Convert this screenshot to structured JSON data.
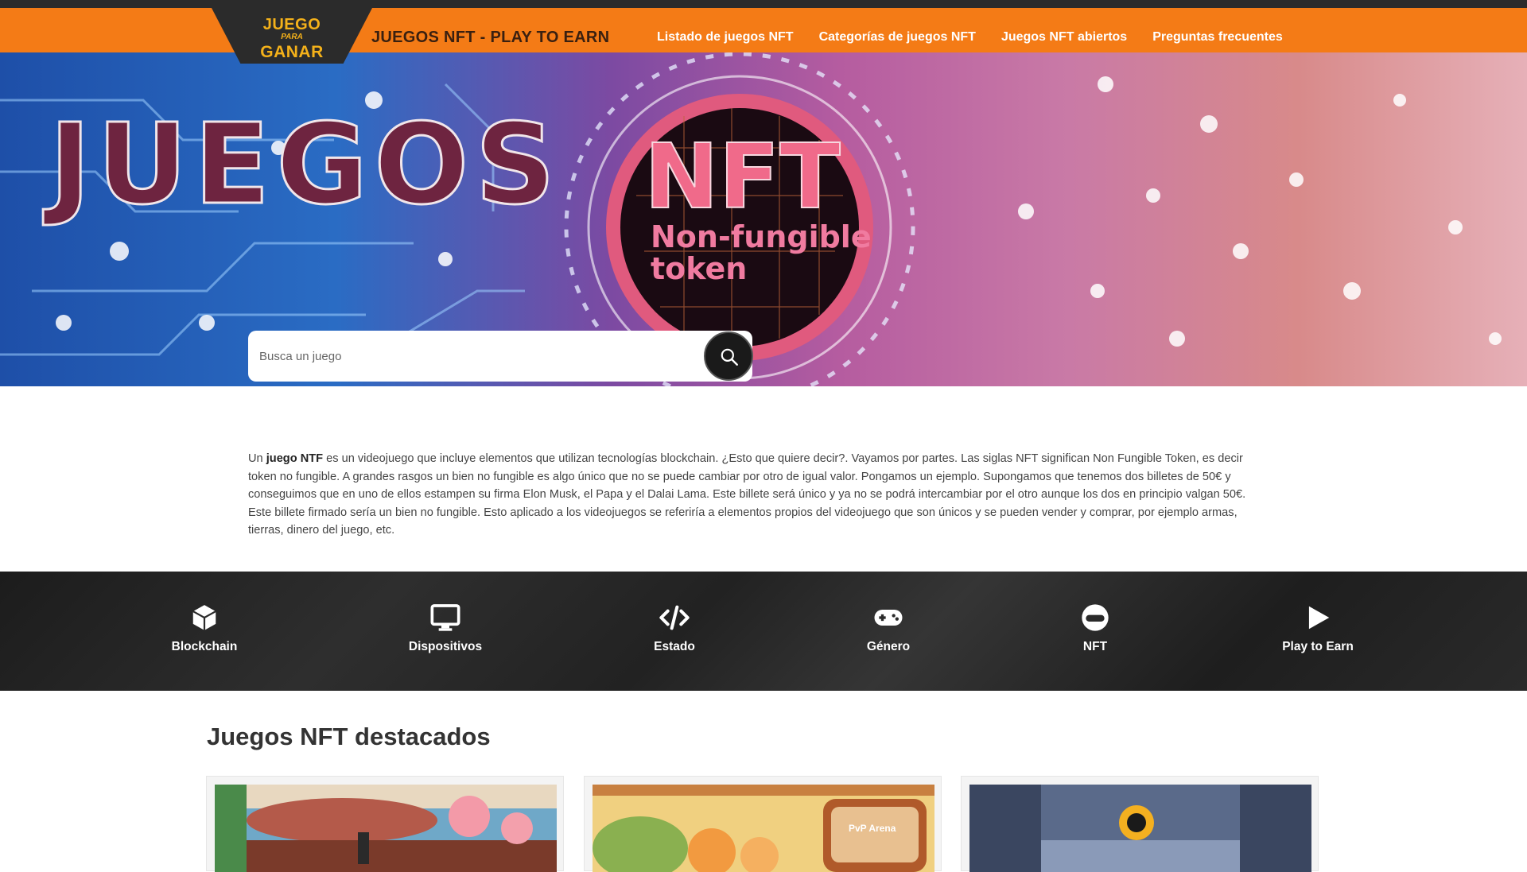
{
  "logo": {
    "line1": "JUEGO",
    "line2": "PARA",
    "line3": "GANAR"
  },
  "brand_text": "JUEGOS NFT - PLAY TO EARN",
  "nav": [
    {
      "label": "Listado de juegos NFT"
    },
    {
      "label": "Categorías de juegos NFT"
    },
    {
      "label": "Juegos NFT abiertos"
    },
    {
      "label": "Preguntas frecuentes"
    }
  ],
  "hero": {
    "title": "JUEGOS",
    "badge_title": "NFT",
    "badge_sub_1": "Non-fungible",
    "badge_sub_2": "token"
  },
  "search": {
    "placeholder": "Busca un juego",
    "value": ""
  },
  "intro": {
    "lead": "Un ",
    "bold": "juego NTF",
    "rest": " es un videojuego que incluye elementos que utilizan tecnologías blockchain. ¿Esto que quiere decir?. Vayamos por partes. Las siglas  NFT significan Non Fungible Token, es decir token no fungible. A grandes rasgos un bien no fungible es algo único que no se puede cambiar por otro de igual valor. Pongamos un ejemplo. Supongamos que tenemos dos billetes de 50€ y conseguimos que en uno de ellos estampen su firma Elon Musk, el Papa y el Dalai Lama. Este billete será único y ya no se podrá intercambiar por el otro aunque los dos en principio valgan 50€. Este billete firmado sería un bien no fungible. Esto aplicado a los videojuegos se referiría a elementos propios del videojuego que son únicos y se pueden vender y comprar, por ejemplo armas, tierras, dinero del juego, etc."
  },
  "categories": [
    {
      "label": "Blockchain",
      "icon": "cube-icon"
    },
    {
      "label": "Dispositivos",
      "icon": "monitor-icon"
    },
    {
      "label": "Estado",
      "icon": "code-icon"
    },
    {
      "label": "Género",
      "icon": "gamepad-icon"
    },
    {
      "label": "NFT",
      "icon": "token-icon"
    },
    {
      "label": "Play to Earn",
      "icon": "play-icon"
    }
  ],
  "featured": {
    "title": "Juegos NFT destacados",
    "cards": [
      {
        "name": "game-card-1",
        "badge": ""
      },
      {
        "name": "game-card-2",
        "badge": "PvP Arena"
      },
      {
        "name": "game-card-3",
        "badge": ""
      }
    ]
  },
  "colors": {
    "nav": "#f47b16",
    "logo_bg": "#2b2b2b",
    "logo_text": "#f4b11a",
    "hero_title": "#6e2440",
    "nft_pink": "#f06a8a"
  }
}
